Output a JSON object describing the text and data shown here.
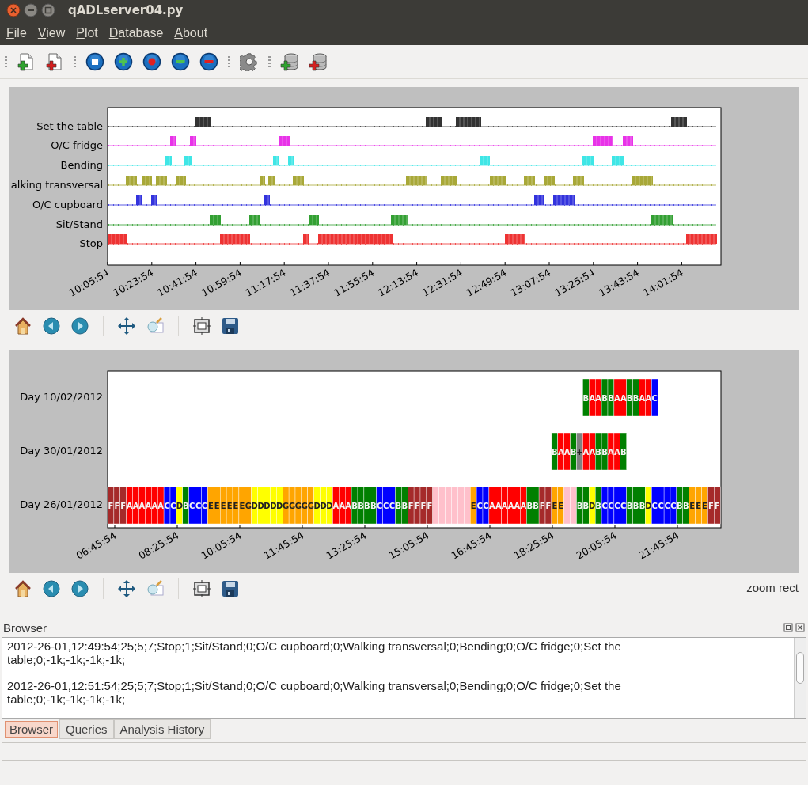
{
  "window": {
    "title": "qADLserver04.py"
  },
  "menu": [
    "File",
    "View",
    "Plot",
    "Database",
    "About"
  ],
  "activity_plot": {
    "rows": [
      {
        "label": "Set the table",
        "color": "#333333"
      },
      {
        "label": "O/C fridge",
        "color": "#e833e8"
      },
      {
        "label": "Bending",
        "color": "#3fe6e6"
      },
      {
        "label": "alking transversal",
        "color": "#a8a838"
      },
      {
        "label": "O/C cupboard",
        "color": "#3333dd"
      },
      {
        "label": "Sit/Stand",
        "color": "#33a033"
      },
      {
        "label": "Stop",
        "color": "#ee3333"
      }
    ],
    "x_ticks": [
      "10:05:54",
      "10:23:54",
      "10:41:54",
      "10:59:54",
      "11:17:54",
      "11:37:54",
      "11:55:54",
      "12:13:54",
      "12:31:54",
      "12:49:54",
      "13:07:54",
      "13:25:54",
      "13:43:54",
      "14:01:54"
    ]
  },
  "day_plot": {
    "rows": [
      {
        "label": "Day 10/02/2012",
        "cells": [
          "",
          "",
          "",
          "",
          "",
          "",
          "",
          "",
          "",
          "",
          "",
          "",
          "",
          "",
          "",
          "",
          "",
          "",
          "",
          "",
          "",
          "",
          "",
          "",
          "",
          "",
          "",
          "",
          "",
          "",
          "",
          "",
          "",
          "",
          "",
          "",
          "",
          "",
          "",
          "",
          "",
          "",
          "",
          "",
          "",
          "",
          "",
          "",
          "",
          "",
          "",
          "",
          "",
          "",
          "",
          "",
          "",
          "",
          "",
          "",
          "",
          "",
          "",
          "",
          "",
          "",
          "",
          "",
          "",
          "",
          "",
          "",
          "",
          "",
          "",
          "",
          {
            "letter": "B",
            "color": "#008000"
          },
          {
            "letter": "A",
            "color": "#ff0000"
          },
          {
            "letter": "A",
            "color": "#ff0000"
          },
          {
            "letter": "B",
            "color": "#008000"
          },
          {
            "letter": "B",
            "color": "#008000"
          },
          {
            "letter": "A",
            "color": "#ff0000"
          },
          {
            "letter": "A",
            "color": "#ff0000"
          },
          {
            "letter": "B",
            "color": "#008000"
          },
          {
            "letter": "B",
            "color": "#008000"
          },
          {
            "letter": "A",
            "color": "#ff0000"
          },
          {
            "letter": "A",
            "color": "#ff0000"
          },
          {
            "letter": "C",
            "color": "#0000ff"
          }
        ]
      },
      {
        "label": "Day 30/01/2012",
        "cells": [
          "",
          "",
          "",
          "",
          "",
          "",
          "",
          "",
          "",
          "",
          "",
          "",
          "",
          "",
          "",
          "",
          "",
          "",
          "",
          "",
          "",
          "",
          "",
          "",
          "",
          "",
          "",
          "",
          "",
          "",
          "",
          "",
          "",
          "",
          "",
          "",
          "",
          "",
          "",
          "",
          "",
          "",
          "",
          "",
          "",
          "",
          "",
          "",
          "",
          "",
          "",
          "",
          "",
          "",
          "",
          "",
          "",
          "",
          "",
          "",
          "",
          "",
          "",
          "",
          "",
          "",
          "",
          "",
          "",
          "",
          "",
          {
            "letter": "B",
            "color": "#008000"
          },
          {
            "letter": "A",
            "color": "#ff0000"
          },
          {
            "letter": "A",
            "color": "#ff0000"
          },
          {
            "letter": "B",
            "color": "#008000"
          },
          {
            "letter": "+",
            "color": "#808080"
          },
          {
            "letter": "A",
            "color": "#ff0000"
          },
          {
            "letter": "A",
            "color": "#ff0000"
          },
          {
            "letter": "B",
            "color": "#008000"
          },
          {
            "letter": "B",
            "color": "#008000"
          },
          {
            "letter": "A",
            "color": "#ff0000"
          },
          {
            "letter": "A",
            "color": "#ff0000"
          },
          {
            "letter": "B",
            "color": "#008000"
          }
        ]
      },
      {
        "label": "Day 26/01/2012",
        "cells": [
          {
            "letter": "F",
            "color": "#a52a2a"
          },
          {
            "letter": "F",
            "color": "#a52a2a"
          },
          {
            "letter": "F",
            "color": "#a52a2a"
          },
          {
            "letter": "A",
            "color": "#ff0000"
          },
          {
            "letter": "A",
            "color": "#ff0000"
          },
          {
            "letter": "A",
            "color": "#ff0000"
          },
          {
            "letter": "A",
            "color": "#ff0000"
          },
          {
            "letter": "A",
            "color": "#ff0000"
          },
          {
            "letter": "A",
            "color": "#ff0000"
          },
          {
            "letter": "C",
            "color": "#0000ff"
          },
          {
            "letter": "C",
            "color": "#0000ff"
          },
          {
            "letter": "D",
            "color": "#ffff00"
          },
          {
            "letter": "B",
            "color": "#008000"
          },
          {
            "letter": "C",
            "color": "#0000ff"
          },
          {
            "letter": "C",
            "color": "#0000ff"
          },
          {
            "letter": "C",
            "color": "#0000ff"
          },
          {
            "letter": "E",
            "color": "#ffa500"
          },
          {
            "letter": "E",
            "color": "#ffa500"
          },
          {
            "letter": "E",
            "color": "#ffa500"
          },
          {
            "letter": "E",
            "color": "#ffa500"
          },
          {
            "letter": "E",
            "color": "#ffa500"
          },
          {
            "letter": "E",
            "color": "#ffa500"
          },
          {
            "letter": "G",
            "color": "#ffa500"
          },
          {
            "letter": "D",
            "color": "#ffff00"
          },
          {
            "letter": "D",
            "color": "#ffff00"
          },
          {
            "letter": "D",
            "color": "#ffff00"
          },
          {
            "letter": "D",
            "color": "#ffff00"
          },
          {
            "letter": "D",
            "color": "#ffff00"
          },
          {
            "letter": "G",
            "color": "#ffa500"
          },
          {
            "letter": "G",
            "color": "#ffa500"
          },
          {
            "letter": "G",
            "color": "#ffa500"
          },
          {
            "letter": "G",
            "color": "#ffa500"
          },
          {
            "letter": "G",
            "color": "#ffa500"
          },
          {
            "letter": "D",
            "color": "#ffff00"
          },
          {
            "letter": "D",
            "color": "#ffff00"
          },
          {
            "letter": "D",
            "color": "#ffff00"
          },
          {
            "letter": "A",
            "color": "#ff0000"
          },
          {
            "letter": "A",
            "color": "#ff0000"
          },
          {
            "letter": "A",
            "color": "#ff0000"
          },
          {
            "letter": "B",
            "color": "#008000"
          },
          {
            "letter": "B",
            "color": "#008000"
          },
          {
            "letter": "B",
            "color": "#008000"
          },
          {
            "letter": "B",
            "color": "#008000"
          },
          {
            "letter": "C",
            "color": "#0000ff"
          },
          {
            "letter": "C",
            "color": "#0000ff"
          },
          {
            "letter": "C",
            "color": "#0000ff"
          },
          {
            "letter": "B",
            "color": "#008000"
          },
          {
            "letter": "B",
            "color": "#008000"
          },
          {
            "letter": "F",
            "color": "#a52a2a"
          },
          {
            "letter": "F",
            "color": "#a52a2a"
          },
          {
            "letter": "F",
            "color": "#a52a2a"
          },
          {
            "letter": "F",
            "color": "#a52a2a"
          },
          {
            "color": "#ffc0cb"
          },
          {
            "color": "#ffc0cb"
          },
          {
            "color": "#ffc0cb"
          },
          {
            "color": "#ffc0cb"
          },
          {
            "color": "#ffc0cb"
          },
          {
            "color": "#ffc0cb"
          },
          {
            "letter": "E",
            "color": "#ffa500"
          },
          {
            "letter": "C",
            "color": "#0000ff"
          },
          {
            "letter": "C",
            "color": "#0000ff"
          },
          {
            "letter": "A",
            "color": "#ff0000"
          },
          {
            "letter": "A",
            "color": "#ff0000"
          },
          {
            "letter": "A",
            "color": "#ff0000"
          },
          {
            "letter": "A",
            "color": "#ff0000"
          },
          {
            "letter": "A",
            "color": "#ff0000"
          },
          {
            "letter": "A",
            "color": "#ff0000"
          },
          {
            "letter": "B",
            "color": "#008000"
          },
          {
            "letter": "B",
            "color": "#008000"
          },
          {
            "letter": "F",
            "color": "#a52a2a"
          },
          {
            "letter": "F",
            "color": "#a52a2a"
          },
          {
            "letter": "E",
            "color": "#ffa500"
          },
          {
            "letter": "E",
            "color": "#ffa500"
          },
          {
            "color": "#ffc0cb"
          },
          {
            "color": "#ffc0cb"
          },
          {
            "letter": "B",
            "color": "#008000"
          },
          {
            "letter": "B",
            "color": "#008000"
          },
          {
            "letter": "D",
            "color": "#ffff00"
          },
          {
            "letter": "B",
            "color": "#008000"
          },
          {
            "letter": "C",
            "color": "#0000ff"
          },
          {
            "letter": "C",
            "color": "#0000ff"
          },
          {
            "letter": "C",
            "color": "#0000ff"
          },
          {
            "letter": "C",
            "color": "#0000ff"
          },
          {
            "letter": "B",
            "color": "#008000"
          },
          {
            "letter": "B",
            "color": "#008000"
          },
          {
            "letter": "B",
            "color": "#008000"
          },
          {
            "letter": "D",
            "color": "#ffff00"
          },
          {
            "letter": "C",
            "color": "#0000ff"
          },
          {
            "letter": "C",
            "color": "#0000ff"
          },
          {
            "letter": "C",
            "color": "#0000ff"
          },
          {
            "letter": "C",
            "color": "#0000ff"
          },
          {
            "letter": "B",
            "color": "#008000"
          },
          {
            "letter": "B",
            "color": "#008000"
          },
          {
            "letter": "E",
            "color": "#ffa500"
          },
          {
            "letter": "E",
            "color": "#ffa500"
          },
          {
            "letter": "E",
            "color": "#ffa500"
          },
          {
            "letter": "F",
            "color": "#a52a2a"
          },
          {
            "letter": "F",
            "color": "#a52a2a"
          }
        ]
      }
    ],
    "x_ticks": [
      "06:45:54",
      "08:25:54",
      "10:05:54",
      "11:45:54",
      "13:25:54",
      "15:05:54",
      "16:45:54",
      "18:25:54",
      "20:05:54",
      "21:45:54"
    ]
  },
  "plot_status": "zoom rect",
  "browser": {
    "title": "Browser",
    "lines": [
      "2012-26-01,12:49:54;25;5;7;Stop;1;Sit/Stand;0;O/C cupboard;0;Walking transversal;0;Bending;0;O/C fridge;0;Set the table;0;-1k;-1k;-1k;-1k;",
      "2012-26-01,12:51:54;25;5;7;Stop;1;Sit/Stand;0;O/C cupboard;0;Walking transversal;0;Bending;0;O/C fridge;0;Set the table;0;-1k;-1k;-1k;-1k;"
    ]
  },
  "tabs": [
    {
      "label": "Browser",
      "selected": true
    },
    {
      "label": "Queries",
      "selected": false
    },
    {
      "label": "Analysis History",
      "selected": false
    }
  ]
}
